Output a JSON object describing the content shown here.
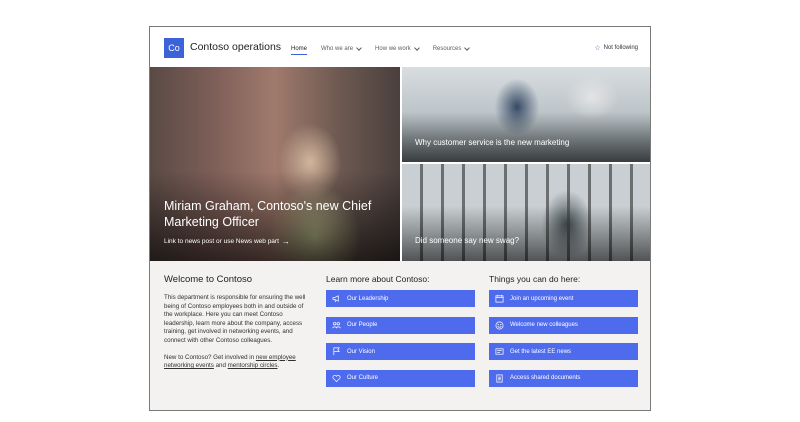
{
  "site": {
    "logo_text": "Co",
    "title": "Contoso operations",
    "follow_label": "Not following",
    "accent_color": "#3b62d9"
  },
  "nav": [
    {
      "label": "Home"
    },
    {
      "label": "Who we are"
    },
    {
      "label": "How we work"
    },
    {
      "label": "Resources"
    }
  ],
  "hero": {
    "main": {
      "title": "Miriam Graham, Contoso's new Chief Marketing Officer",
      "link": "Link to news post or use News web part",
      "arrow": "→"
    },
    "top_right": {
      "title": "Why customer service is the new marketing"
    },
    "bottom_right": {
      "title": "Did someone say new swag?"
    }
  },
  "welcome": {
    "heading": "Welcome to Contoso",
    "body": "This department is responsible for ensuring the well being of Contoso employees both in and outside of the workplace. Here you can meet Contoso leadership, learn more about the company, access training, get involved in networking events, and connect with other Contoso colleagues.",
    "cta_prefix": "New to Contoso? Get involved in ",
    "cta_link1": "new employee networking events",
    "cta_and": " and ",
    "cta_link2": "mentorship circles",
    "cta_suffix": "."
  },
  "learn": {
    "heading": "Learn more about Contoso:",
    "buttons": [
      {
        "label": "Our Leadership",
        "icon": "megaphone-icon"
      },
      {
        "label": "Our People",
        "icon": "people-icon"
      },
      {
        "label": "Our Vision",
        "icon": "flag-icon"
      },
      {
        "label": "Our Culture",
        "icon": "heart-icon"
      }
    ]
  },
  "things": {
    "heading": "Things you can do here:",
    "buttons": [
      {
        "label": "Join an upcoming event",
        "icon": "calendar-icon"
      },
      {
        "label": "Welcome new colleagues",
        "icon": "smiley-icon"
      },
      {
        "label": "Get the latest EE news",
        "icon": "news-icon"
      },
      {
        "label": "Access shared documents",
        "icon": "document-icon"
      }
    ]
  },
  "colors": {
    "button": "#4f6bed",
    "lower_bg": "#f3f2f1"
  }
}
